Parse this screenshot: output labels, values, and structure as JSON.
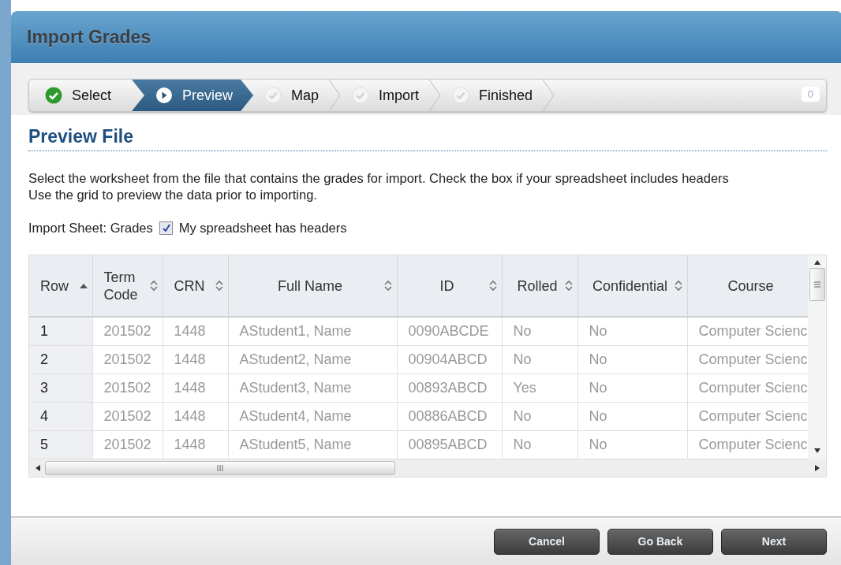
{
  "window": {
    "title": "Import Grades"
  },
  "steps": [
    {
      "label": "Select",
      "done": true,
      "selected": false
    },
    {
      "label": "Preview",
      "done": false,
      "selected": true
    },
    {
      "label": "Map",
      "done": false,
      "selected": false
    },
    {
      "label": "Import",
      "done": false,
      "selected": false
    },
    {
      "label": "Finished",
      "done": false,
      "selected": false
    }
  ],
  "step_counter": "0",
  "section_title": "Preview File",
  "instructions": [
    "Select the worksheet from the file that contains the grades for import. Check the box if your spreadsheet includes headers",
    "Use the grid to preview the data prior to importing."
  ],
  "import_sheet": "Import Sheet: Grades",
  "headers_checkbox": {
    "label": "My spreadsheet has headers",
    "checked": true
  },
  "table": {
    "columns": [
      {
        "label": "Row",
        "sortable": true,
        "sorted": true
      },
      {
        "label": "Term Code",
        "sortable": true,
        "sorted": false
      },
      {
        "label": "CRN",
        "sortable": true,
        "sorted": false
      },
      {
        "label": "Full Name",
        "sortable": true,
        "sorted": false
      },
      {
        "label": "ID",
        "sortable": true,
        "sorted": false
      },
      {
        "label": "Rolled",
        "sortable": true,
        "sorted": false
      },
      {
        "label": "Confidential",
        "sortable": true,
        "sorted": false
      },
      {
        "label": "Course",
        "sortable": false
      }
    ],
    "rows": [
      [
        "1",
        "201502",
        "1448",
        "AStudent1, Name",
        "0090ABCDE",
        "No",
        "No",
        "Computer Scienc"
      ],
      [
        "2",
        "201502",
        "1448",
        "AStudent2, Name",
        "00904ABCD",
        "No",
        "No",
        "Computer Scienc"
      ],
      [
        "3",
        "201502",
        "1448",
        "AStudent3, Name",
        "00893ABCD",
        "Yes",
        "No",
        "Computer Scienc"
      ],
      [
        "4",
        "201502",
        "1448",
        "AStudent4, Name",
        "00886ABCD",
        "No",
        "No",
        "Computer Scienc"
      ],
      [
        "5",
        "201502",
        "1448",
        "AStudent5, Name",
        "00895ABCD",
        "No",
        "No",
        "Computer Scienc"
      ]
    ]
  },
  "buttons": [
    "Cancel",
    "Go Back",
    "Next"
  ]
}
